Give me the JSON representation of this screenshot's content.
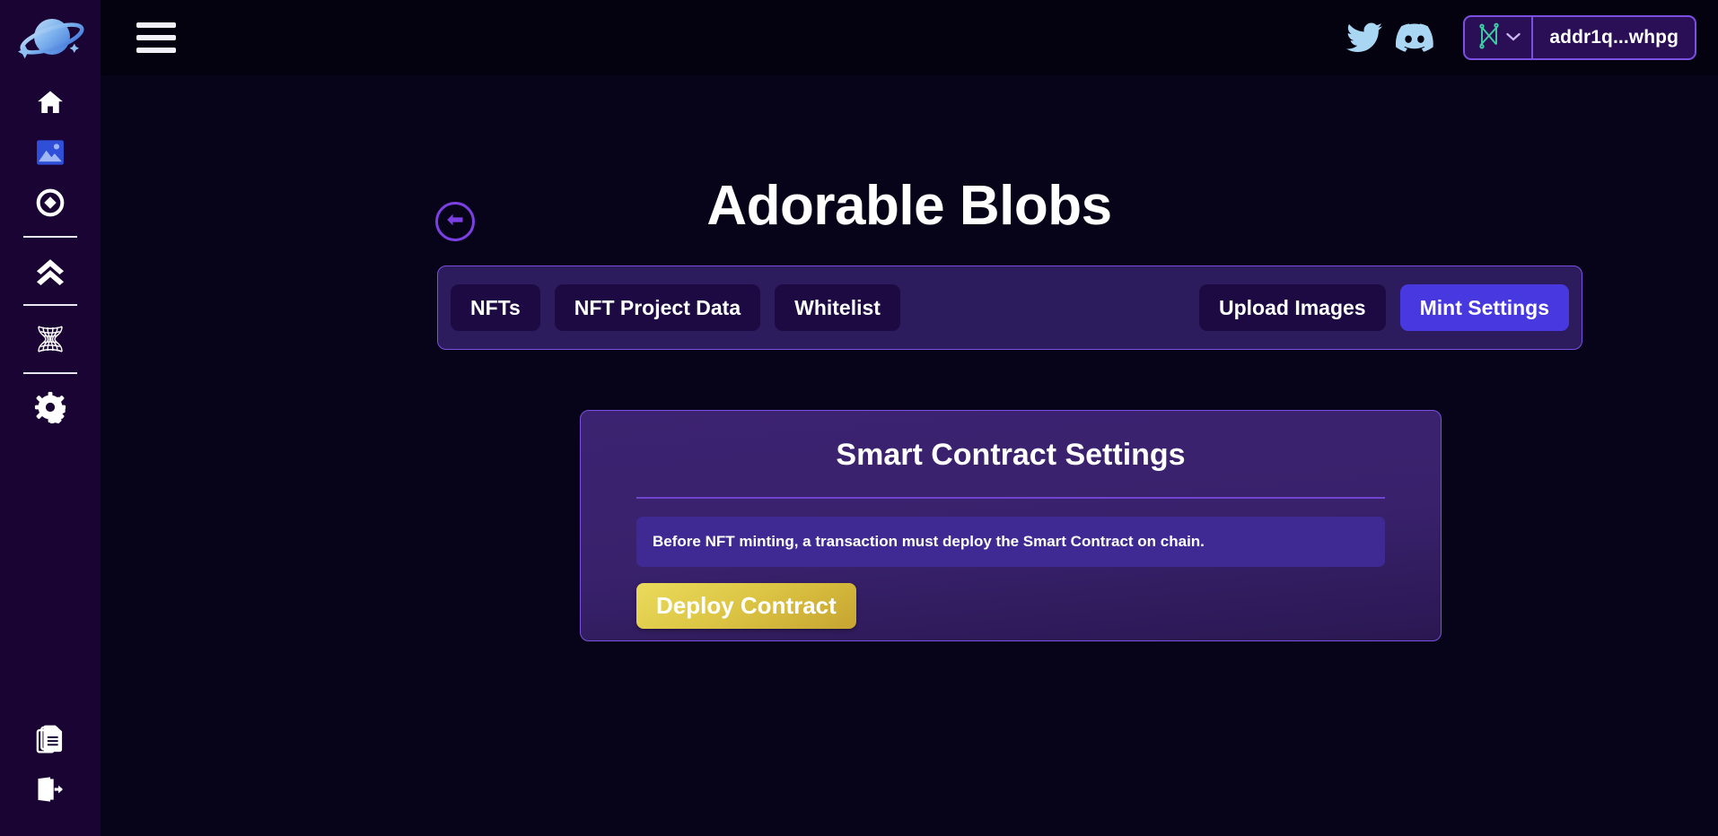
{
  "theme": {
    "background": "#07041a",
    "sidebar_bg": "#190434",
    "topbar_bg": "#05020f",
    "accent_purple": "#7b4fe0",
    "tabbar_bg": "#2d1c5d",
    "tab_inactive_bg": "#1d0a42",
    "tab_active_bg": "#4739df",
    "card_bg": "#3c2371",
    "alert_bg": "#3e2a92",
    "deploy_gold": "#ddc645",
    "text_primary": "#ffffff",
    "social_icon_color": "#a9d6f2",
    "wallet_logo_color": "#3ecfa3"
  },
  "sidebar": {
    "logo": {
      "name": "planet-logo"
    },
    "items": [
      {
        "name": "sidebar-item-home",
        "icon": "home-icon",
        "active": false
      },
      {
        "name": "sidebar-item-images",
        "icon": "image-icon",
        "active": true
      },
      {
        "name": "sidebar-item-token",
        "icon": "token-circle-icon",
        "active": false
      },
      {
        "name": "sidebar-separator-1",
        "icon": "divider",
        "active": false
      },
      {
        "name": "sidebar-item-upgrade",
        "icon": "double-chevron-up-icon",
        "active": false
      },
      {
        "name": "sidebar-separator-2",
        "icon": "divider",
        "active": false
      },
      {
        "name": "sidebar-item-mesh",
        "icon": "mesh-hourglass-icon",
        "active": false
      },
      {
        "name": "sidebar-separator-3",
        "icon": "divider",
        "active": false
      },
      {
        "name": "sidebar-item-settings",
        "icon": "gear-icon",
        "active": false
      }
    ],
    "bottom_items": [
      {
        "name": "sidebar-item-documents",
        "icon": "documents-icon"
      },
      {
        "name": "sidebar-item-logout",
        "icon": "logout-icon"
      }
    ]
  },
  "topbar": {
    "menu_icon": "hamburger-menu-icon",
    "social": [
      {
        "name": "twitter-link",
        "icon": "twitter-icon"
      },
      {
        "name": "discord-link",
        "icon": "discord-icon"
      }
    ],
    "wallet": {
      "logo_icon": "nami-wallet-icon",
      "chevron_icon": "chevron-down-icon",
      "address": "addr1q...whpg"
    }
  },
  "page": {
    "back_button_icon": "arrow-left-circle-icon",
    "title": "Adorable Blobs"
  },
  "tabs": {
    "left": [
      {
        "label": "NFTs",
        "active": false
      },
      {
        "label": "NFT Project Data",
        "active": false
      },
      {
        "label": "Whitelist",
        "active": false
      }
    ],
    "right": [
      {
        "label": "Upload Images",
        "active": false
      },
      {
        "label": "Mint Settings",
        "active": true
      }
    ]
  },
  "card": {
    "title": "Smart Contract Settings",
    "alert": "Before NFT minting, a transaction must deploy the Smart Contract on chain.",
    "deploy_label": "Deploy Contract"
  }
}
